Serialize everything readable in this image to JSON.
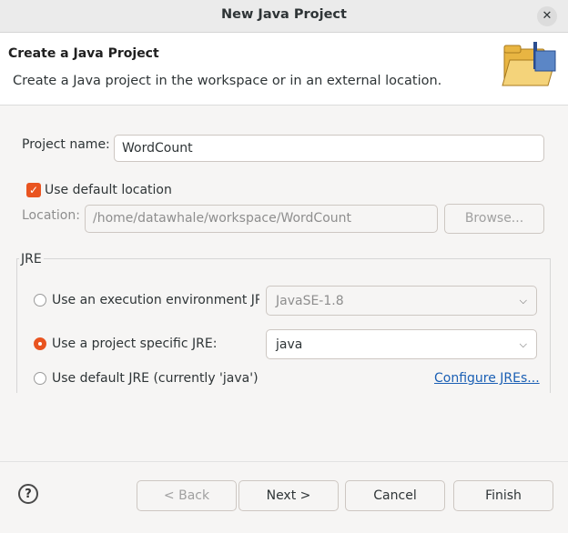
{
  "window": {
    "title": "New Java Project",
    "close_symbol": "✕"
  },
  "banner": {
    "title": "Create a Java Project",
    "description": "Create a Java project in the workspace or in an external location."
  },
  "project_name": {
    "label": "Project name:",
    "value": "WordCount"
  },
  "location": {
    "use_default_label": "Use default location",
    "use_default_checked": true,
    "check_symbol": "✓",
    "label": "Location:",
    "value": "/home/datawhale/workspace/WordCount",
    "browse_label": "Browse..."
  },
  "jre": {
    "group_label": "JRE",
    "option_exec_env": {
      "label": "Use an execution environment JRE",
      "selected": false,
      "value": "JavaSE-1.8"
    },
    "option_project_specific": {
      "label": "Use a project specific JRE:",
      "selected": true,
      "value": "java"
    },
    "option_default": {
      "label": "Use default JRE (currently 'java')",
      "selected": false
    },
    "configure_link": "Configure JREs..."
  },
  "footer": {
    "help_symbol": "?",
    "back_label": "< Back",
    "next_label": "Next >",
    "cancel_label": "Cancel",
    "finish_label": "Finish"
  },
  "colors": {
    "accent": "#e95420",
    "link": "#1a5fb4"
  }
}
